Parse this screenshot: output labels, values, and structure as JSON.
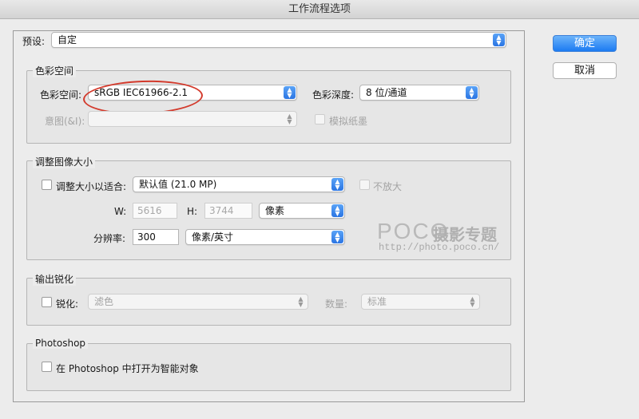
{
  "window": {
    "title": "工作流程选项"
  },
  "preset": {
    "label": "预设:",
    "value": "自定"
  },
  "buttons": {
    "ok": "确定",
    "cancel": "取消"
  },
  "color_space_group": {
    "title": "色彩空间",
    "space_label": "色彩空间:",
    "space_value": "sRGB IEC61966-2.1",
    "depth_label": "色彩深度:",
    "depth_value": "8 位/通道",
    "intent_label": "意图(&I):",
    "intent_value": "",
    "simulate_paper_label": "模拟纸墨"
  },
  "resize_group": {
    "title": "调整图像大小",
    "resize_fit_label": "调整大小以适合:",
    "resize_fit_value": "默认值 (21.0 MP)",
    "no_enlarge_label": "不放大",
    "w_label": "W:",
    "w_value": "5616",
    "h_label": "H:",
    "h_value": "3744",
    "unit_value": "像素",
    "resolution_label": "分辨率:",
    "resolution_value": "300",
    "resolution_unit_value": "像素/英寸"
  },
  "sharpen_group": {
    "title": "输出锐化",
    "sharpen_label": "锐化:",
    "sharpen_value": "滤色",
    "amount_label": "数量:",
    "amount_value": "标准"
  },
  "photoshop_group": {
    "title": "Photoshop",
    "smart_object_label": "在 Photoshop 中打开为智能对象"
  },
  "watermark": {
    "logo": "POCO",
    "brand": "摄影专题",
    "url": "http://photo.poco.cn/"
  },
  "colors": {
    "accent": "#2b75e3",
    "annotation": "#d33a2c"
  }
}
